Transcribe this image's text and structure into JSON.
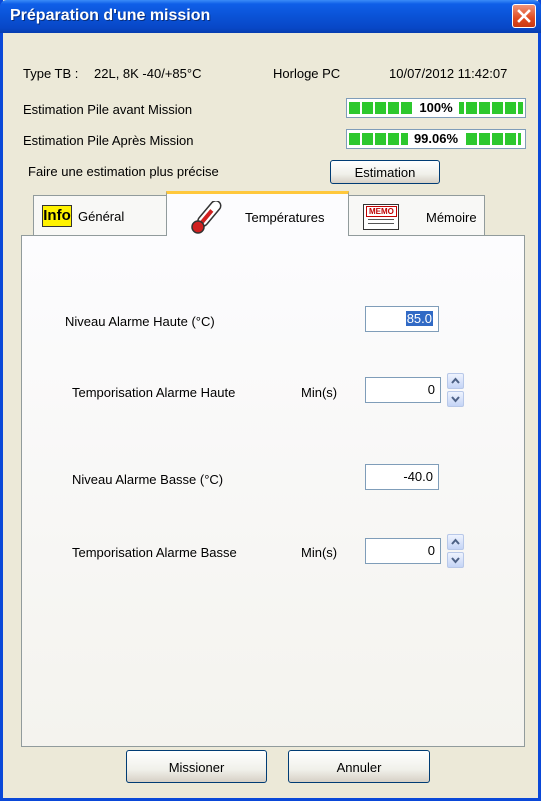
{
  "window": {
    "title": "Préparation d'une mission"
  },
  "info": {
    "type_label": "Type TB :",
    "type_value": "22L, 8K -40/+85°C",
    "clock_label": "Horloge PC",
    "clock_value": "10/07/2012 11:42:07"
  },
  "battery": {
    "before_label": "Estimation Pile avant Mission",
    "before_value": "100%",
    "before_fraction": 1.0,
    "after_label": "Estimation Pile Après Mission",
    "after_value": "99.06%",
    "after_fraction": 0.9906,
    "bar_color": "#2DC82D"
  },
  "estimate": {
    "label": "Faire une estimation plus précise",
    "button": "Estimation"
  },
  "tabs": [
    {
      "label": "Général",
      "icon": "info-icon",
      "icon_text": "Info"
    },
    {
      "label": "Températures",
      "icon": "thermometer-icon"
    },
    {
      "label": "Mémoire",
      "icon": "memo-icon",
      "icon_text": "MEMO"
    }
  ],
  "active_tab": "Températures",
  "temperatures": {
    "high_level_label": "Niveau Alarme Haute (°C)",
    "high_level_value": "85.0",
    "high_delay_label": "Temporisation Alarme Haute",
    "high_delay_unit": "Min(s)",
    "high_delay_value": "0",
    "low_level_label": "Niveau Alarme Basse (°C)",
    "low_level_value": "-40.0",
    "low_delay_label": "Temporisation Alarme Basse",
    "low_delay_unit": "Min(s)",
    "low_delay_value": "0"
  },
  "footer": {
    "ok": "Missioner",
    "cancel": "Annuler"
  },
  "colors": {
    "titlebar": "#0A52D6",
    "close": "#E04B20",
    "active_tab_accent": "#FFC83C",
    "selection": "#316AC5"
  }
}
